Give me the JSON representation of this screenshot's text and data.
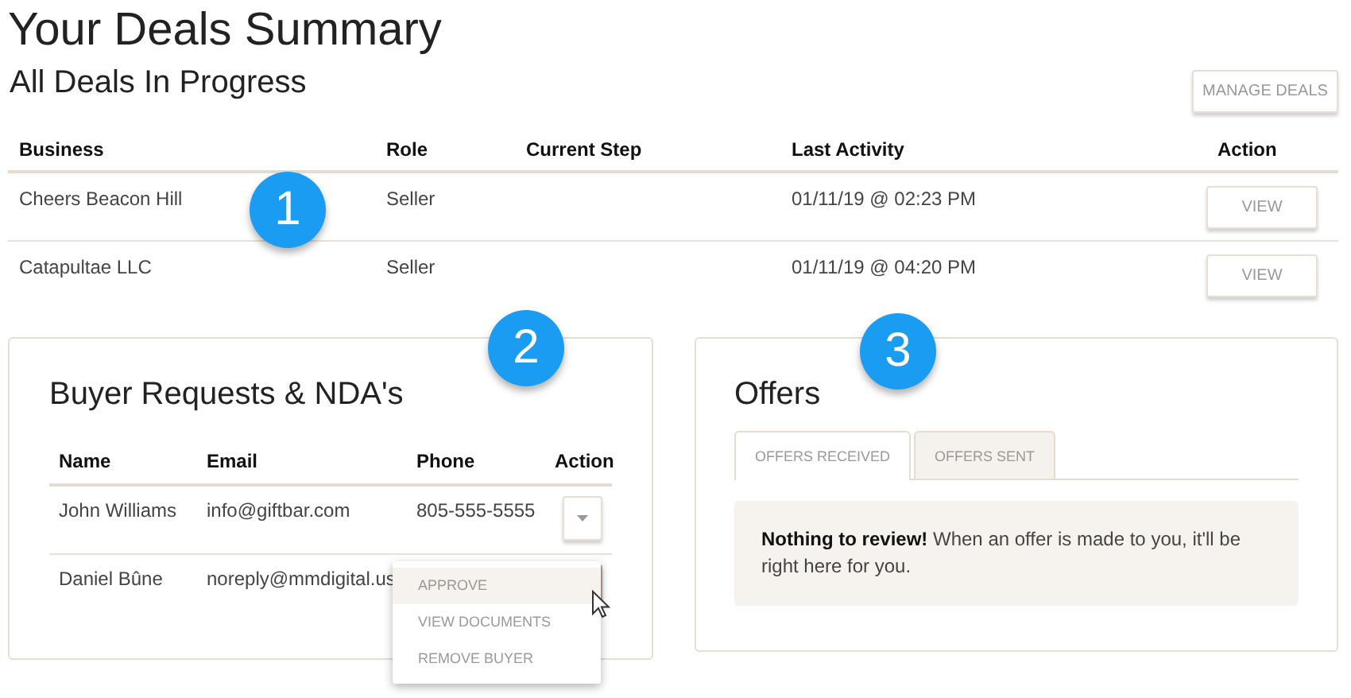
{
  "page": {
    "title": "Your Deals Summary",
    "subtitle": "All Deals In Progress",
    "manage_button": "MANAGE DEALS"
  },
  "deals_table": {
    "columns": [
      "Business",
      "Role",
      "Current Step",
      "Last Activity",
      "Action"
    ],
    "rows": [
      {
        "business": "Cheers Beacon Hill",
        "role": "Seller",
        "last_activity": "01/11/19 @ 02:23 PM",
        "action": "VIEW"
      },
      {
        "business": "Catapultae LLC",
        "role": "Seller",
        "last_activity": "01/11/19 @ 04:20 PM",
        "action": "VIEW"
      }
    ]
  },
  "buyer_requests": {
    "title": "Buyer Requests & NDA's",
    "columns": [
      "Name",
      "Email",
      "Phone",
      "Action"
    ],
    "rows": [
      {
        "name": "John Williams",
        "email": "info@giftbar.com",
        "phone": "805-555-5555",
        "menu_open": false
      },
      {
        "name": "Daniel Bûne",
        "email": "noreply@mmdigital.us",
        "menu_open": true,
        "menu": [
          {
            "label": "APPROVE",
            "selected": true
          },
          {
            "label": "VIEW DOCUMENTS",
            "selected": false
          },
          {
            "label": "REMOVE BUYER",
            "selected": false
          }
        ]
      }
    ]
  },
  "offers": {
    "title": "Offers",
    "tabs": [
      {
        "label": "OFFERS RECEIVED",
        "selected": true
      },
      {
        "label": "OFFERS SENT",
        "selected": false
      }
    ],
    "notice": "**Nothing to review!** When an offer is made to you, it'll be right here for you."
  },
  "callouts": [
    "1",
    "2",
    "3"
  ]
}
